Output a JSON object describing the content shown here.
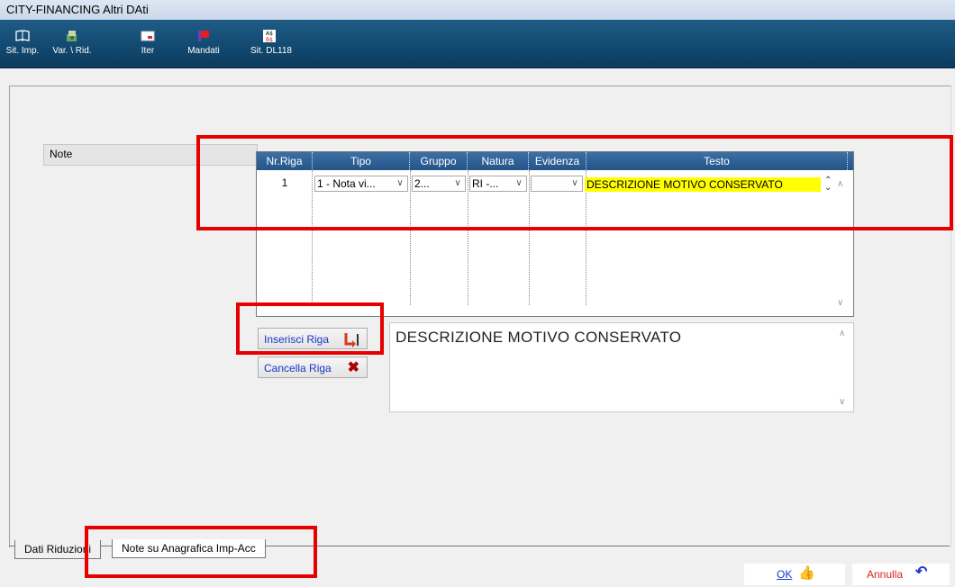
{
  "window": {
    "title": "CITY-FINANCING  Altri DAti"
  },
  "toolbar": {
    "items": [
      {
        "label": "Sit. Imp.",
        "icon": "book-icon"
      },
      {
        "label": "Var. \\ Rid.",
        "icon": "money-icon"
      },
      {
        "label": "Iter",
        "icon": "card-icon"
      },
      {
        "label": "Mandati",
        "icon": "flag-icon"
      },
      {
        "label": "Sit. DL118",
        "icon": "currency-icon"
      }
    ]
  },
  "note_section": {
    "label": "Note"
  },
  "grid": {
    "columns": [
      "Nr.Riga",
      "Tipo",
      "Gruppo",
      "Natura",
      "Evidenza",
      "Testo"
    ],
    "rows": [
      {
        "nr": "1",
        "tipo": "1 - Nota vi...",
        "gruppo": "2...",
        "natura": "RI -...",
        "evidenza": "",
        "testo": "DESCRIZIONE MOTIVO CONSERVATO"
      }
    ]
  },
  "buttons": {
    "insert": "Inserisci Riga",
    "delete": "Cancella Riga",
    "ok": "OK",
    "cancel": "Annulla"
  },
  "memo": {
    "text": "DESCRIZIONE MOTIVO CONSERVATO"
  },
  "tabs": [
    {
      "label": "Dati Riduzioni",
      "active": false
    },
    {
      "label": "Note su Anagrafica Imp-Acc",
      "active": true
    }
  ],
  "colors": {
    "toolbar": "#124a71",
    "grid_header": "#24558a",
    "highlight": "#ffff00",
    "annotation": "#e60000"
  }
}
